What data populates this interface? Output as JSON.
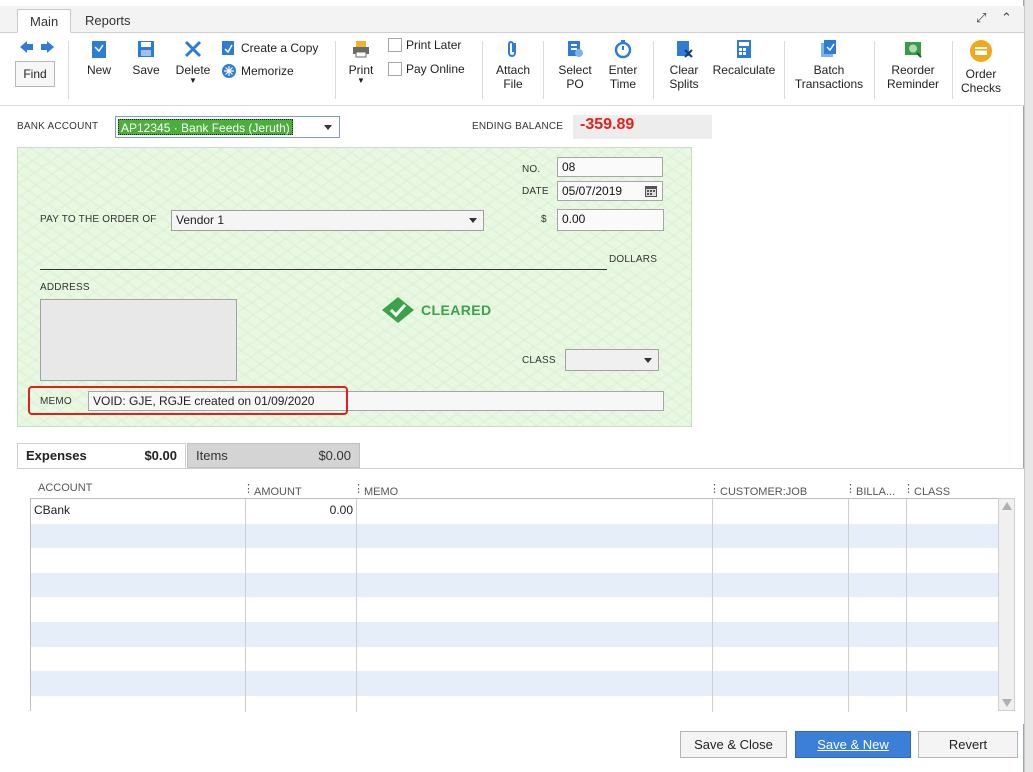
{
  "window": {
    "tabs": [
      "Main",
      "Reports"
    ]
  },
  "toolbar": {
    "find": "Find",
    "new": "New",
    "save": "Save",
    "delete": "Delete",
    "create_copy": "Create a Copy",
    "memorize": "Memorize",
    "print": "Print",
    "print_later": "Print Later",
    "pay_online": "Pay Online",
    "attach_file": [
      "Attach",
      "File"
    ],
    "select_po": [
      "Select",
      "PO"
    ],
    "enter_time": [
      "Enter",
      "Time"
    ],
    "clear_splits": [
      "Clear",
      "Splits"
    ],
    "recalculate": "Recalculate",
    "batch_transactions": [
      "Batch",
      "Transactions"
    ],
    "reorder_reminder": [
      "Reorder",
      "Reminder"
    ],
    "order_checks": [
      "Order",
      "Checks"
    ]
  },
  "header": {
    "bank_account_label": "BANK ACCOUNT",
    "bank_account_value": "AP12345 · Bank Feeds (Jeruth)",
    "ending_balance_label": "ENDING BALANCE",
    "ending_balance_value": "-359.89"
  },
  "check": {
    "no_label": "NO.",
    "no_value": "08",
    "date_label": "DATE",
    "date_value": "05/07/2019",
    "amount_label": "$",
    "amount_value": "0.00",
    "payto_label": "PAY TO THE ORDER OF",
    "payee_value": "Vendor 1",
    "dollars_label": "DOLLARS",
    "address_label": "ADDRESS",
    "status": "CLEARED",
    "class_label": "CLASS",
    "memo_label": "MEMO",
    "memo_value": "VOID: GJE, RGJE created on 01/09/2020"
  },
  "detail": {
    "expenses_tab": "Expenses",
    "expenses_total": "$0.00",
    "items_tab": "Items",
    "items_total": "$0.00",
    "columns": [
      "ACCOUNT",
      "AMOUNT",
      "MEMO",
      "CUSTOMER:JOB",
      "BILLA...",
      "CLASS"
    ],
    "rows": [
      {
        "account": "CBank",
        "amount": "0.00"
      }
    ]
  },
  "footer": {
    "save_close": "Save & Close",
    "save_new": "Save & New",
    "revert": "Revert"
  },
  "colors": {
    "accent_blue": "#3c7fd8",
    "balance_red": "#e3231a",
    "cleared_green": "#3aa34a",
    "check_bg": "#e9f8e2",
    "row_stripe": "#e6eef9"
  }
}
